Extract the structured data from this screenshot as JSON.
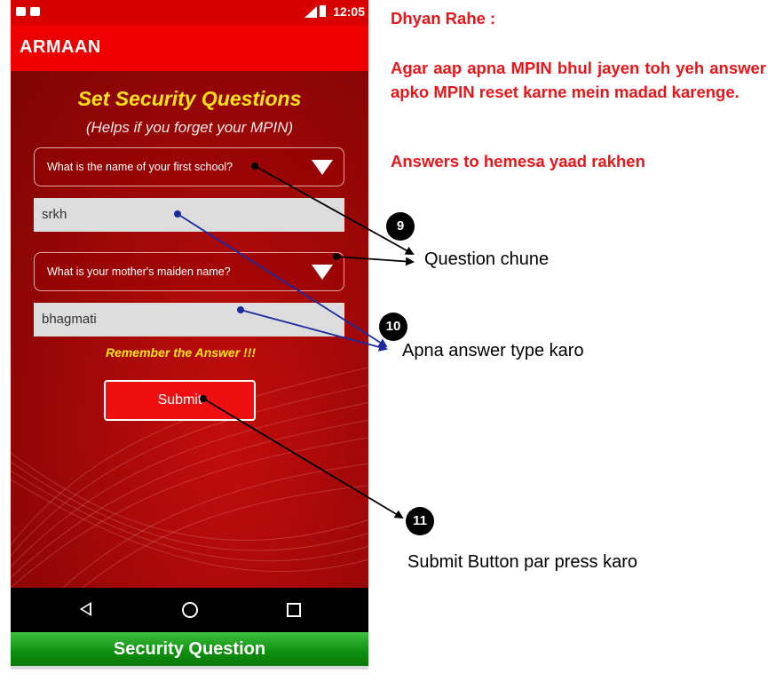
{
  "phone": {
    "status": {
      "time": "12:05"
    },
    "app_title": "ARMAAN",
    "heading": "Set Security Questions",
    "subheading": "(Helps if you forget your MPIN)",
    "question1": {
      "selected": "What is the name of your first school?"
    },
    "answer1": {
      "value": "srkh"
    },
    "question2": {
      "selected": "What is your mother's maiden name?"
    },
    "answer2": {
      "value": "bhagmati"
    },
    "remember_text": "Remember the Answer !!!",
    "submit_label": "Submit",
    "nav_icons": [
      "back-icon",
      "home-icon",
      "recents-icon"
    ]
  },
  "footer_banner": "Security Question",
  "notes": {
    "title": "Dhyan Rahe :",
    "body": "Agar aap apna MPIN bhul jayen toh yeh answer apko MPIN reset karne mein madad karenge.",
    "answers_line": "Answers to hemesa yaad rakhen"
  },
  "callouts": [
    {
      "number": "9",
      "text": "Question chune"
    },
    {
      "number": "10",
      "text": "Apna answer type karo"
    },
    {
      "number": "11",
      "text": "Submit Button par press karo"
    }
  ],
  "colors": {
    "app_bar": "#ef0000",
    "note_text": "#e8161a",
    "heading": "#ffe21a",
    "footer_banner": "#0e8e0e",
    "arrow_black": "#000000",
    "arrow_blue": "#1a2a9c"
  }
}
